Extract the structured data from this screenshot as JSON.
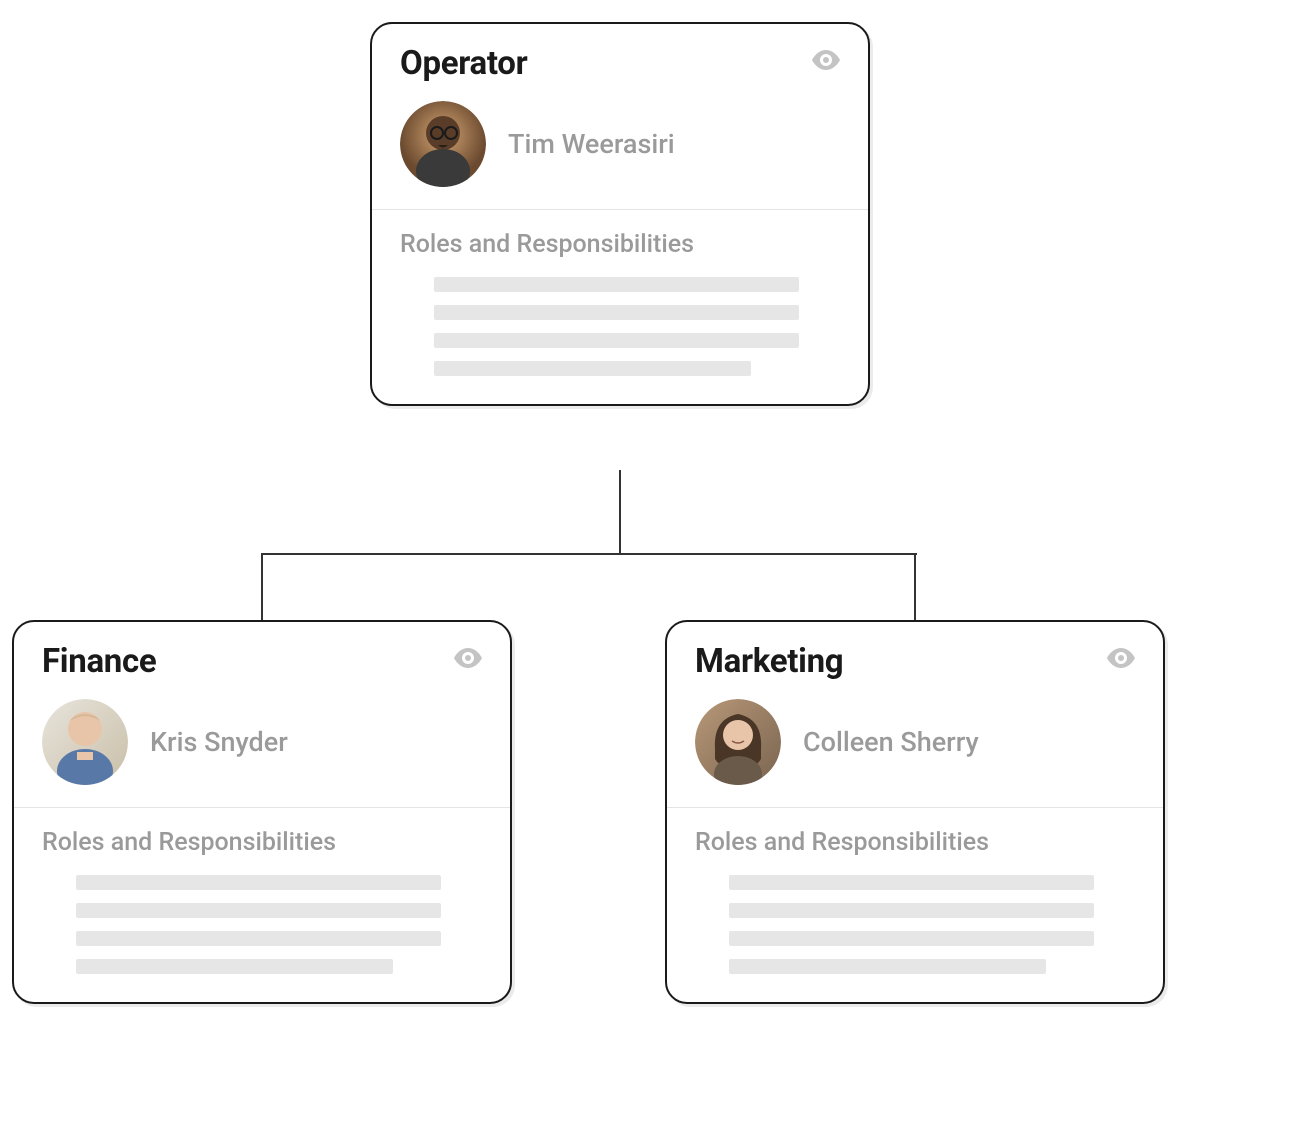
{
  "cards": {
    "operator": {
      "title": "Operator",
      "person_name": "Tim Weerasiri",
      "roles_label": "Roles and Responsibilities"
    },
    "finance": {
      "title": "Finance",
      "person_name": "Kris Snyder",
      "roles_label": "Roles and Responsibilities"
    },
    "marketing": {
      "title": "Marketing",
      "person_name": "Colleen Sherry",
      "roles_label": "Roles and Responsibilities"
    }
  },
  "icons": {
    "visibility": "eye-icon"
  }
}
